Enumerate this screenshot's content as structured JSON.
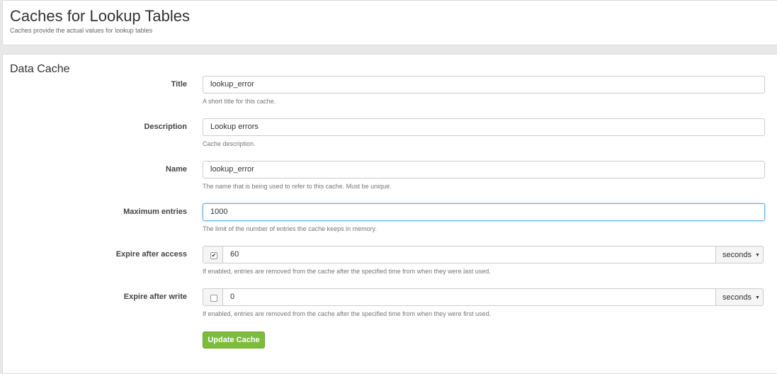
{
  "page": {
    "title": "Caches for Lookup Tables",
    "subtitle": "Caches provide the actual values for lookup tables"
  },
  "form": {
    "section_title": "Data Cache",
    "fields": {
      "title": {
        "label": "Title",
        "value": "lookup_error",
        "help": "A short title for this cache."
      },
      "description": {
        "label": "Description",
        "value": "Lookup errors",
        "help": "Cache description."
      },
      "name": {
        "label": "Name",
        "value": "lookup_error",
        "help": "The name that is being used to refer to this cache. Must be unique."
      },
      "max_entries": {
        "label": "Maximum entries",
        "value": "1000",
        "help": "The limit of the number of entries the cache keeps in memory."
      },
      "expire_after_access": {
        "label": "Expire after access",
        "checked": true,
        "check_glyph": "✔",
        "value": "60",
        "unit": "seconds",
        "help": "If enabled, entries are removed from the cache after the specified time from when they were last used."
      },
      "expire_after_write": {
        "label": "Expire after write",
        "checked": false,
        "check_glyph": "",
        "value": "0",
        "unit": "seconds",
        "help": "If enabled, entries are removed from the cache after the specified time from when they were first used."
      }
    },
    "submit_label": "Update Cache"
  },
  "colors": {
    "submit_button": "#7cbd3c",
    "focus_border": "#66afe9"
  },
  "icons": {
    "caret": "caret-down-icon",
    "check": "check-icon"
  }
}
